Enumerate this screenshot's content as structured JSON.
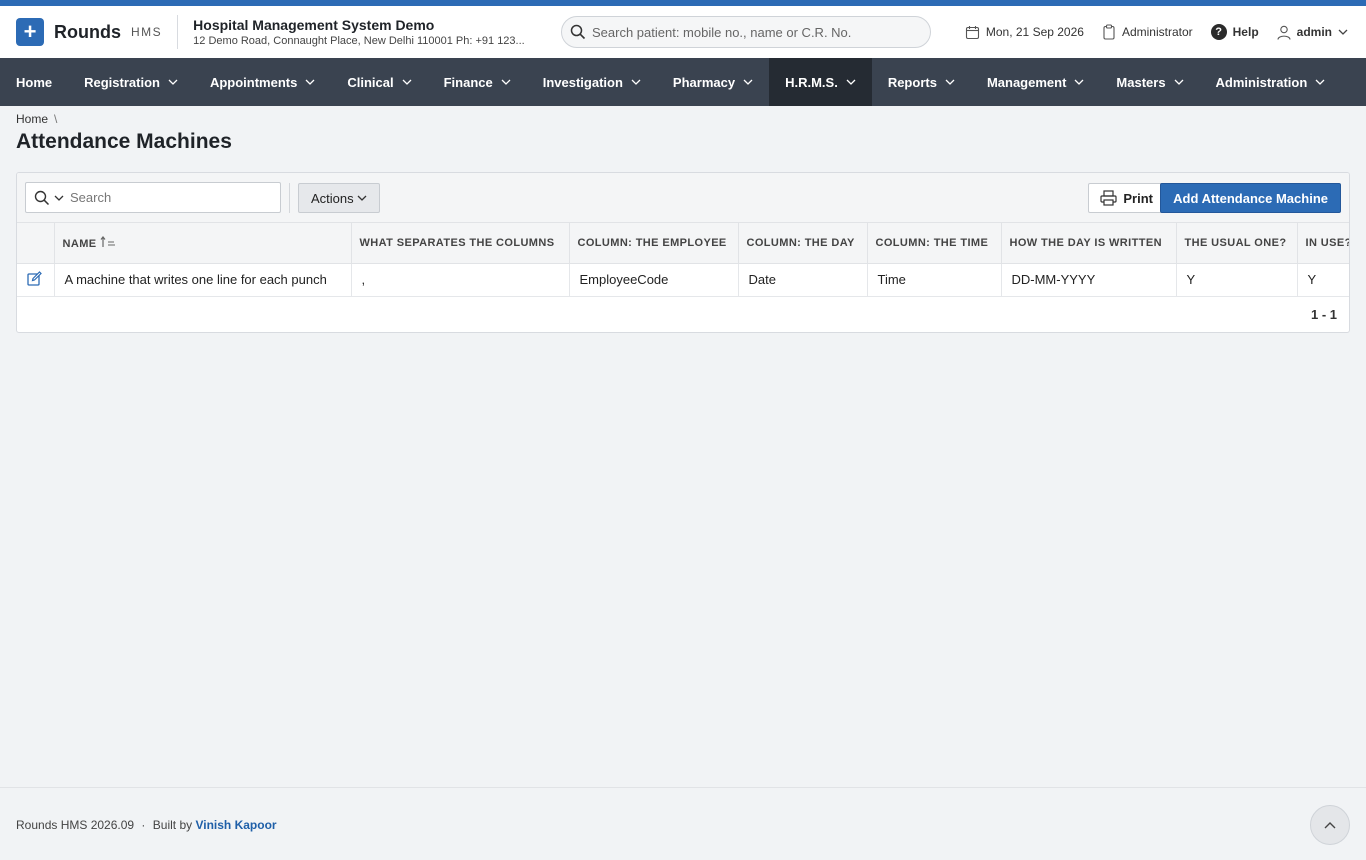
{
  "brand": {
    "name": "Rounds",
    "sub": "HMS",
    "logo_icon": "plus-icon",
    "accent": "#2c6bb5"
  },
  "org": {
    "name": "Hospital Management System Demo",
    "address": "12 Demo Road, Connaught Place, New Delhi 110001 Ph: +91 123..."
  },
  "search": {
    "placeholder": "Search patient: mobile no., name or C.R. No."
  },
  "topbar": {
    "date": "Mon, 21 Sep 2026",
    "role": "Administrator",
    "help": "Help",
    "user": "admin"
  },
  "nav": [
    {
      "label": "Home",
      "dropdown": false
    },
    {
      "label": "Registration",
      "dropdown": true
    },
    {
      "label": "Appointments",
      "dropdown": true
    },
    {
      "label": "Clinical",
      "dropdown": true
    },
    {
      "label": "Finance",
      "dropdown": true
    },
    {
      "label": "Investigation",
      "dropdown": true
    },
    {
      "label": "Pharmacy",
      "dropdown": true
    },
    {
      "label": "H.R.M.S.",
      "dropdown": true,
      "active": true
    },
    {
      "label": "Reports",
      "dropdown": true
    },
    {
      "label": "Management",
      "dropdown": true
    },
    {
      "label": "Masters",
      "dropdown": true
    },
    {
      "label": "Administration",
      "dropdown": true
    }
  ],
  "breadcrumb": {
    "home": "Home",
    "separator": "\\"
  },
  "page": {
    "title": "Attendance Machines"
  },
  "toolbar": {
    "search_placeholder": "Search",
    "actions_label": "Actions",
    "print_label": "Print",
    "add_label": "Add Attendance Machine"
  },
  "table": {
    "columns": [
      "",
      "NAME",
      "WHAT SEPARATES THE COLUMNS",
      "COLUMN: THE EMPLOYEE",
      "COLUMN: THE DAY",
      "COLUMN: THE TIME",
      "HOW THE DAY IS WRITTEN",
      "THE USUAL ONE?",
      "IN USE?"
    ],
    "sort": {
      "column": "NAME",
      "direction": "ascending"
    },
    "rows": [
      [
        "",
        "A machine that writes one line for each punch",
        ",",
        "EmployeeCode",
        "Date",
        "Time",
        "DD-MM-YYYY",
        "Y",
        "Y"
      ]
    ]
  },
  "pagination": {
    "range": "1 - 1"
  },
  "footer": {
    "version": "Rounds HMS 2026.09",
    "dot": "·",
    "built_by": "Built by",
    "author": "Vinish Kapoor"
  }
}
